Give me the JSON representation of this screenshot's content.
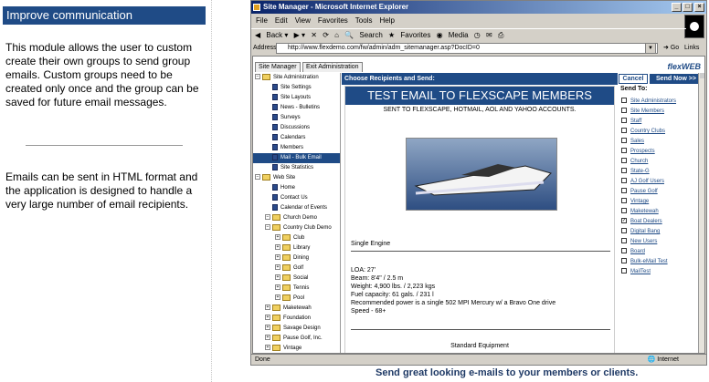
{
  "left_panel": {
    "heading": "Improve communication",
    "para1": "This module allows the user to custom create their own groups to send group emails.  Custom groups need to be created only once and the group can be saved for future email messages.",
    "para2": "Emails can be sent in HTML format and the application is designed to handle a very large number of email recipients."
  },
  "window": {
    "title": "Site Manager - Microsoft Internet Explorer",
    "menu": [
      "File",
      "Edit",
      "View",
      "Favorites",
      "Tools",
      "Help"
    ],
    "toolbar": [
      "Back",
      "Search",
      "Favorites",
      "Media"
    ],
    "address_label": "Address",
    "address": "http://www.flexdemo.com/fw/admin/adm_sitemanager.asp?DocID=0",
    "go": "Go",
    "links": "Links",
    "status_text": "Done",
    "status_zone": "Internet"
  },
  "app": {
    "tabs": [
      "Site Manager",
      "Exit Administration"
    ],
    "logo": "flexWEB",
    "tree": [
      {
        "label": "Site Administration",
        "level": 0
      },
      {
        "label": "Site Settings",
        "level": 1
      },
      {
        "label": "Site Layouts",
        "level": 1
      },
      {
        "label": "News - Bulletins",
        "level": 1
      },
      {
        "label": "Surveys",
        "level": 1
      },
      {
        "label": "Discussions",
        "level": 1
      },
      {
        "label": "Calendars",
        "level": 1
      },
      {
        "label": "Members",
        "level": 1
      },
      {
        "label": "Mail - Bulk Email",
        "level": 1
      },
      {
        "label": "Site Statistics",
        "level": 1
      },
      {
        "label": "Web Site",
        "level": 0
      },
      {
        "label": "Home",
        "level": 1
      },
      {
        "label": "Contact Us",
        "level": 1
      },
      {
        "label": "Calendar of Events",
        "level": 1
      },
      {
        "label": "Church Demo",
        "level": 1
      },
      {
        "label": "Country Club Demo",
        "level": 1
      },
      {
        "label": "Club",
        "level": 2
      },
      {
        "label": "Library",
        "level": 2
      },
      {
        "label": "Dining",
        "level": 2
      },
      {
        "label": "Golf",
        "level": 2
      },
      {
        "label": "Social",
        "level": 2
      },
      {
        "label": "Tennis",
        "level": 2
      },
      {
        "label": "Pool",
        "level": 2
      },
      {
        "label": "Maketewah",
        "level": 1
      },
      {
        "label": "Foundation",
        "level": 1
      },
      {
        "label": "Savage Design",
        "level": 1
      },
      {
        "label": "Pause Golf, Inc.",
        "level": 1
      },
      {
        "label": "Vintage",
        "level": 1
      }
    ],
    "main_header": "Choose Recipients and Send:",
    "email": {
      "banner": "TEST EMAIL TO FLEXSCAPE MEMBERS",
      "subtitle": "SENT TO FLEXSCAPE, HOTMAIL, AOL AND YAHOO ACCOUNTS.",
      "engine": "Single Engine",
      "specs": [
        "LOA: 27'",
        "Beam: 8'4\" / 2.5 m",
        "Weight: 4,900 lbs. / 2,223 kgs",
        "Fuel capacity: 61 gals. / 231 l",
        "Recommended power is a single 502 MPI Mercury w/ a Bravo One drive",
        "Speed - 68+"
      ],
      "standard": "Standard Equipment"
    },
    "cancel": "Cancel",
    "send": "Send Now >>",
    "send_to": "Send To:",
    "recipients": [
      {
        "label": "Site Administrators",
        "checked": false
      },
      {
        "label": "Site Members",
        "checked": false
      },
      {
        "label": "Staff",
        "checked": false
      },
      {
        "label": "Country Clubs",
        "checked": false
      },
      {
        "label": "Sales",
        "checked": false
      },
      {
        "label": "Prospects",
        "checked": false
      },
      {
        "label": "Church",
        "checked": false
      },
      {
        "label": "State-G",
        "checked": false
      },
      {
        "label": "AJ Golf Users",
        "checked": false
      },
      {
        "label": "Pause Golf",
        "checked": false
      },
      {
        "label": "Vintage",
        "checked": false
      },
      {
        "label": "Maketewah",
        "checked": false
      },
      {
        "label": "Boat Dealers",
        "checked": true
      },
      {
        "label": "Digital Bang",
        "checked": false
      },
      {
        "label": "New Users",
        "checked": false
      },
      {
        "label": "Board",
        "checked": false
      },
      {
        "label": "Bulk-eMail Test",
        "checked": false
      },
      {
        "label": "MailTest",
        "checked": false
      }
    ]
  },
  "caption": "Send great looking e-mails to your members or clients."
}
